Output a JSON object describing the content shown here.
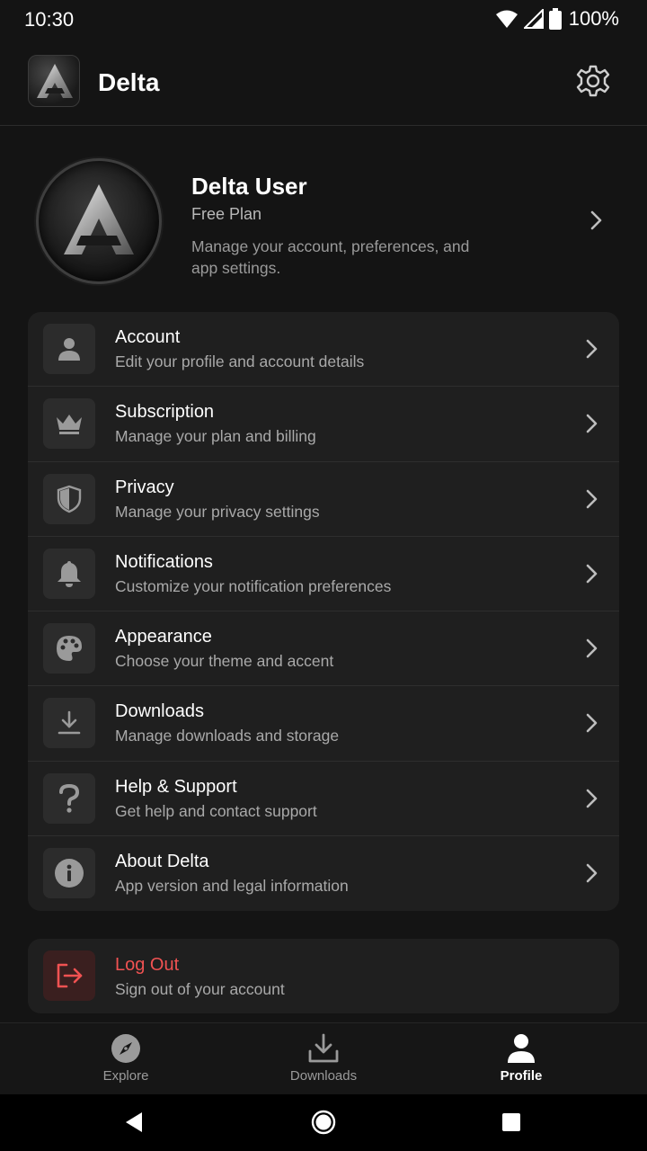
{
  "status_bar": {
    "time": "10:30",
    "battery": "100%"
  },
  "app_bar": {
    "title": "Delta"
  },
  "profile": {
    "name": "Delta User",
    "plan": "Free Plan",
    "description": "Manage your account, preferences, and app settings."
  },
  "menu": {
    "items": [
      {
        "icon": "person-icon",
        "title": "Account",
        "subtitle": "Edit your profile and account details"
      },
      {
        "icon": "crown-icon",
        "title": "Subscription",
        "subtitle": "Manage your plan and billing"
      },
      {
        "icon": "shield-icon",
        "title": "Privacy",
        "subtitle": "Manage your privacy settings"
      },
      {
        "icon": "bell-icon",
        "title": "Notifications",
        "subtitle": "Customize your notification preferences"
      },
      {
        "icon": "palette-icon",
        "title": "Appearance",
        "subtitle": "Choose your theme and accent"
      },
      {
        "icon": "download-icon",
        "title": "Downloads",
        "subtitle": "Manage downloads and storage"
      },
      {
        "icon": "question-icon",
        "title": "Help & Support",
        "subtitle": "Get help and contact support"
      },
      {
        "icon": "info-icon",
        "title": "About Delta",
        "subtitle": "App version and legal information"
      }
    ]
  },
  "logout": {
    "title": "Log Out",
    "subtitle": "Sign out of your account",
    "accent_color": "#f05252"
  },
  "bottom_nav": {
    "items": [
      {
        "icon": "compass-icon",
        "label": "Explore",
        "active": false
      },
      {
        "icon": "download-icon",
        "label": "Downloads",
        "active": false
      },
      {
        "icon": "person-icon",
        "label": "Profile",
        "active": true
      }
    ]
  },
  "colors": {
    "background": "#141414",
    "card": "#1f1f1f",
    "icon_box": "#2c2c2c",
    "muted_text": "#a9a9a9"
  }
}
